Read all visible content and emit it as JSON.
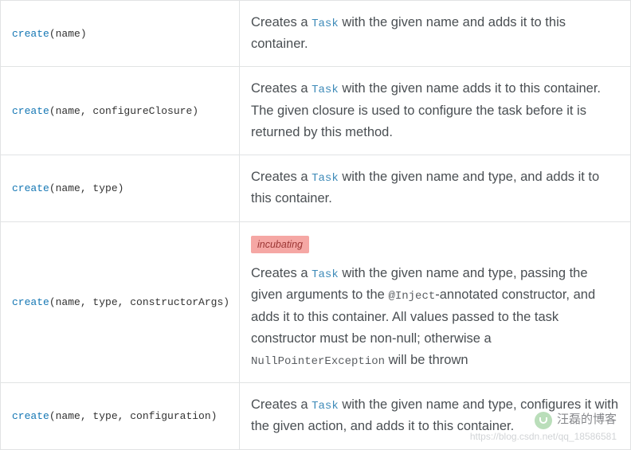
{
  "rows": [
    {
      "method": "create",
      "args": "(name)",
      "badge": null,
      "desc_parts": [
        {
          "t": "Creates a ",
          "k": "text"
        },
        {
          "t": "Task",
          "k": "code"
        },
        {
          "t": " with the given name and adds it to this container.",
          "k": "text"
        }
      ]
    },
    {
      "method": "create",
      "args": "(name, configureClosure)",
      "badge": null,
      "desc_parts": [
        {
          "t": "Creates a ",
          "k": "text"
        },
        {
          "t": "Task",
          "k": "code"
        },
        {
          "t": " with the given name adds it to this container. The given closure is used to configure the task before it is returned by this method.",
          "k": "text"
        }
      ]
    },
    {
      "method": "create",
      "args": "(name, type)",
      "badge": null,
      "desc_parts": [
        {
          "t": "Creates a ",
          "k": "text"
        },
        {
          "t": "Task",
          "k": "code"
        },
        {
          "t": " with the given name and type, and adds it to this container.",
          "k": "text"
        }
      ]
    },
    {
      "method": "create",
      "args": "(name, type, constructorArgs)",
      "badge": "incubating",
      "desc_parts": [
        {
          "t": "Creates a ",
          "k": "text"
        },
        {
          "t": "Task",
          "k": "code"
        },
        {
          "t": " with the given name and type, passing the given arguments to the ",
          "k": "text"
        },
        {
          "t": "@Inject",
          "k": "code_plain"
        },
        {
          "t": "-annotated constructor, and adds it to this container. All values passed to the task constructor must be non-null; otherwise a ",
          "k": "text"
        },
        {
          "t": "NullPointerException",
          "k": "code_plain"
        },
        {
          "t": " will be thrown",
          "k": "text"
        }
      ]
    },
    {
      "method": "create",
      "args": "(name, type, configuration)",
      "badge": null,
      "desc_parts": [
        {
          "t": "Creates a ",
          "k": "text"
        },
        {
          "t": "Task",
          "k": "code"
        },
        {
          "t": " with the given name and type, configures it with the given action, and adds it to this container.",
          "k": "text"
        }
      ]
    }
  ],
  "watermark": {
    "line1": "汪磊的博客",
    "line2": "https://blog.csdn.net/qq_18586581"
  }
}
